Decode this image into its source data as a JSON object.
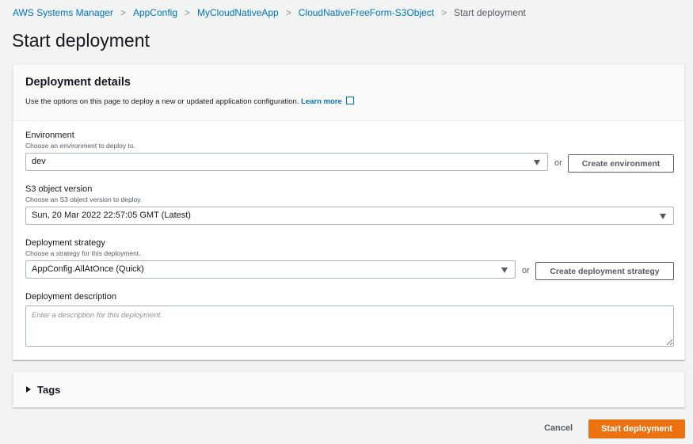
{
  "breadcrumb": [
    "AWS Systems Manager",
    "AppConfig",
    "MyCloudNativeApp",
    "CloudNativeFreeForm-S3Object",
    "Start deployment"
  ],
  "page_title": "Start deployment",
  "details": {
    "title": "Deployment details",
    "description": "Use the options on this page to deploy a new or updated application configuration.",
    "learn_more": "Learn more"
  },
  "environment": {
    "label": "Environment",
    "description": "Choose an environment to deploy to.",
    "value": "dev",
    "or": "or",
    "create_button": "Create environment"
  },
  "s3_version": {
    "label": "S3 object version",
    "description": "Choose an S3 object version to deploy.",
    "value": "Sun, 20 Mar 2022 22:57:05 GMT (Latest)"
  },
  "strategy": {
    "label": "Deployment strategy",
    "description": "Choose a strategy for this deployment.",
    "value": "AppConfig.AllAtOnce (Quick)",
    "or": "or",
    "create_button": "Create deployment strategy"
  },
  "deployment_description": {
    "label": "Deployment description",
    "placeholder": "Enter a description for this deployment."
  },
  "tags": {
    "label": "Tags"
  },
  "footer": {
    "cancel": "Cancel",
    "start": "Start deployment"
  }
}
